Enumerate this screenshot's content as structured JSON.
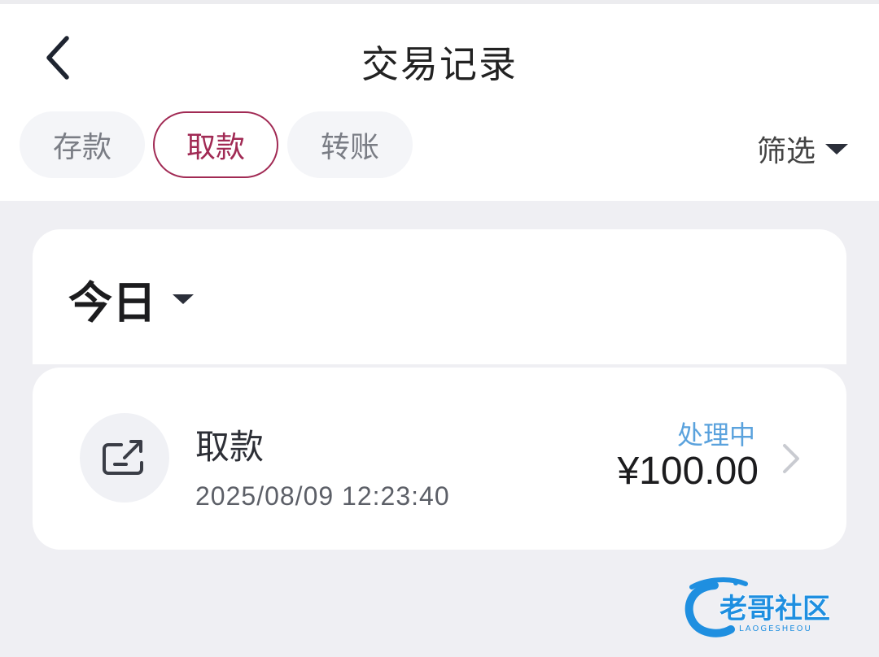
{
  "header": {
    "title": "交易记录",
    "back_icon": "chevron-left-icon"
  },
  "tabs": [
    {
      "label": "存款",
      "active": false
    },
    {
      "label": "取款",
      "active": true
    },
    {
      "label": "转账",
      "active": false
    }
  ],
  "filter": {
    "label": "筛选",
    "icon": "caret-down-icon"
  },
  "period": {
    "label": "今日",
    "icon": "caret-down-icon"
  },
  "records": [
    {
      "type": "取款",
      "time": "2025/08/09 12:23:40",
      "status": "处理中",
      "amount": "¥100.00",
      "icon": "withdraw-icon"
    }
  ],
  "watermark": {
    "text": "老哥社区",
    "subtext": "LAOGESHEOU"
  },
  "colors": {
    "accent": "#a12a54",
    "status_processing": "#5aa2dd",
    "page_background": "#efeff3"
  }
}
